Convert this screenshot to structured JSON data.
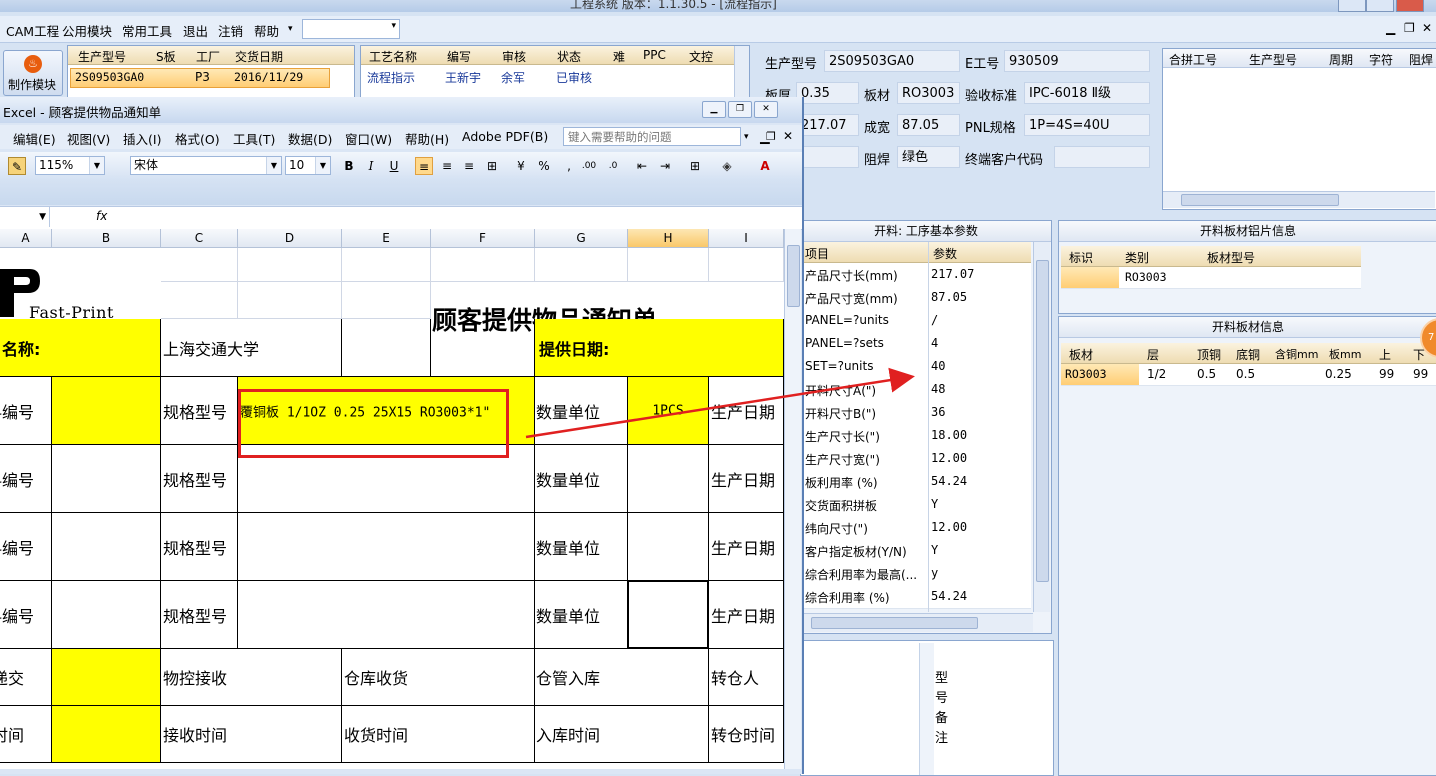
{
  "window_title": "工程系统   版本：1.1.30.5 - [流程指示]",
  "main_menu": [
    "CAM工程",
    "公用模块",
    "常用工具",
    "退出",
    "注销",
    "帮助"
  ],
  "make_module_label": "制作模块",
  "prod_grid": {
    "headers": [
      "生产型号",
      "S板",
      "工厂",
      "交货日期"
    ],
    "row": [
      "2S09503GA0",
      "",
      "P3",
      "2016/11/29"
    ]
  },
  "proc_grid": {
    "headers": [
      "工艺名称",
      "编写",
      "审核",
      "状态",
      "难",
      "PPC",
      "文控"
    ],
    "row": [
      "流程指示",
      "王新宇",
      "余军",
      "已审核",
      "",
      "",
      ""
    ]
  },
  "info": {
    "prod_model_label": "生产型号",
    "prod_model": "2S09503GA0",
    "eng_no_label": "E工号",
    "eng_no": "930509",
    "thickness_label": "板厚",
    "thickness": "0.35",
    "material_label": "板材",
    "material": "RO3003",
    "standard_label": "验收标准",
    "standard": "IPC-6018 Ⅱ级",
    "length": "217.07",
    "width_label": "成宽",
    "width": "87.05",
    "pnl_label": "PNL规格",
    "pnl": "1P=4S=40U",
    "mask_label": "阻焊",
    "mask": "绿色",
    "customer_label": "终端客户代码",
    "customer": ""
  },
  "merge_grid_headers": [
    "合拼工号",
    "生产型号",
    "周期",
    "字符",
    "阻焊"
  ],
  "params_panel": {
    "title": "开料: 工序基本参数",
    "headers": [
      "项目",
      "参数"
    ],
    "rows": [
      {
        "k": "产品尺寸长(mm)",
        "v": "217.07"
      },
      {
        "k": "产品尺寸宽(mm)",
        "v": "87.05"
      },
      {
        "k": "PANEL=?units",
        "v": "/"
      },
      {
        "k": "PANEL=?sets",
        "v": "4"
      },
      {
        "k": "SET=?units",
        "v": "40"
      },
      {
        "k": "开料尺寸A(\")",
        "v": "48"
      },
      {
        "k": "开料尺寸B(\")",
        "v": "36"
      },
      {
        "k": "生产尺寸长(\")",
        "v": "18.00"
      },
      {
        "k": "生产尺寸宽(\")",
        "v": "12.00"
      },
      {
        "k": "板利用率 (%)",
        "v": "54.24"
      },
      {
        "k": "交货面积拼板",
        "v": "Y"
      },
      {
        "k": "纬向尺寸(\")",
        "v": "12.00"
      },
      {
        "k": "客户指定板材(Y/N)",
        "v": "Y"
      },
      {
        "k": "综合利用率为最高(...",
        "v": "y"
      },
      {
        "k": "综合利用率 (%)",
        "v": "54.24"
      }
    ]
  },
  "left_bottom_vertical_label": "型号备注",
  "alu_panel": {
    "title": "开料板材铝片信息",
    "headers": [
      "标识",
      "类别",
      "板材型号"
    ],
    "row": [
      "",
      "RO3003",
      ""
    ]
  },
  "board_panel": {
    "title": "开料板材信息",
    "headers": [
      "板材",
      "层",
      "顶铜",
      "底铜",
      "含铜mm",
      "板mm",
      "上",
      "下"
    ],
    "row": [
      "RO3003",
      "1/2",
      "0.5",
      "0.5",
      "",
      "0.25",
      "99",
      "99"
    ]
  },
  "badge_text": "7",
  "excel": {
    "title": "Excel - 顾客提供物品通知单",
    "menu": [
      "编辑(E)",
      "视图(V)",
      "插入(I)",
      "格式(O)",
      "工具(T)",
      "数据(D)",
      "窗口(W)",
      "帮助(H)",
      "Adobe PDF(B)"
    ],
    "help_placeholder": "键入需要帮助的问题",
    "zoom": "115%",
    "font": "宋体",
    "font_size": "10",
    "columns": [
      "A",
      "B",
      "C",
      "D",
      "E",
      "F",
      "G",
      "H",
      "I"
    ],
    "logo_text": "Fast-Print",
    "doc_title": "顾客提供物品通知单",
    "customer_label": "客户名称:",
    "customer_value": "上海交通大学",
    "date_label": "提供日期:",
    "item_no": "物料编号",
    "spec_label": "规格型号",
    "spec_value": "覆铜板 1/1OZ  0.25 25X15 RO3003*1\"",
    "qty_label": "数量单位",
    "qty_value": "1PCS",
    "prod_date": "生产日期",
    "deliver": "递交",
    "mc_receive": "物控接收",
    "wh_receive": "仓库收货",
    "wh_in": "仓管入库",
    "transfer": "转仓人",
    "time": "时间",
    "receive_time": "接收时间",
    "goods_time": "收货时间",
    "in_time": "入库时间",
    "transfer_time": "转仓时间"
  },
  "accent_colors": {
    "highlight": "#ffff00",
    "annotation": "#e02020",
    "grid_head": "#eedcb2"
  }
}
